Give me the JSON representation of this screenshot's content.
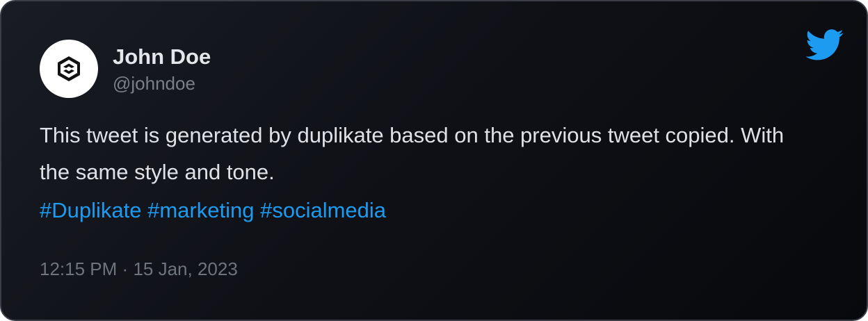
{
  "author": {
    "name": "John Doe",
    "handle": "@johndoe",
    "avatar_icon": "geometric-logo-icon"
  },
  "platform_icon": "twitter-bird-icon",
  "tweet": {
    "text": "This tweet is generated by duplikate based on the previous tweet copied. With the same style and tone.",
    "hashtags": [
      "#Duplikate",
      "#marketing",
      "#socialmedia"
    ],
    "time": "12:15 PM",
    "separator": "·",
    "date": "15 Jan, 2023"
  },
  "colors": {
    "background": "#0f1117",
    "border": "#3a3d45",
    "name": "#e4e6ea",
    "handle": "#7b7f88",
    "text": "#dfe1e5",
    "hashtag": "#1d9bf0",
    "timestamp": "#6f737c",
    "twitter_blue": "#1d9bf0"
  }
}
